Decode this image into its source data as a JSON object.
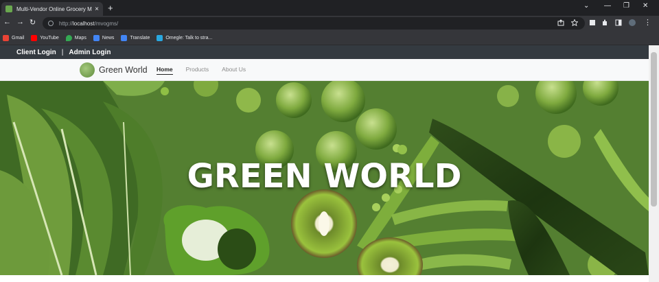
{
  "browser": {
    "tab_title": "Multi-Vendor Online Grocery M",
    "tab_close": "×",
    "new_tab": "+",
    "url_prefix": "http://",
    "url_host": "localhost",
    "url_path": "/mvogms/",
    "bookmarks": [
      {
        "label": "Gmail",
        "color": "#ea4335"
      },
      {
        "label": "YouTube",
        "color": "#ff0000"
      },
      {
        "label": "Maps",
        "color": "#34a853"
      },
      {
        "label": "News",
        "color": "#4285f4"
      },
      {
        "label": "Translate",
        "color": "#4285f4"
      },
      {
        "label": "Omegle: Talk to stra...",
        "color": "#29a8e0"
      }
    ]
  },
  "topbar": {
    "client_login": "Client Login",
    "separator": "|",
    "admin_login": "Admin Login"
  },
  "nav": {
    "brand": "Green World",
    "links": [
      {
        "label": "Home",
        "active": true
      },
      {
        "label": "Products",
        "active": false
      },
      {
        "label": "About Us",
        "active": false
      }
    ]
  },
  "hero": {
    "title": "GREEN WORLD"
  },
  "colors": {
    "topbar_bg": "#343a40",
    "hero_bg": "#4f7c2c",
    "brand_green": "#6aa84f"
  }
}
